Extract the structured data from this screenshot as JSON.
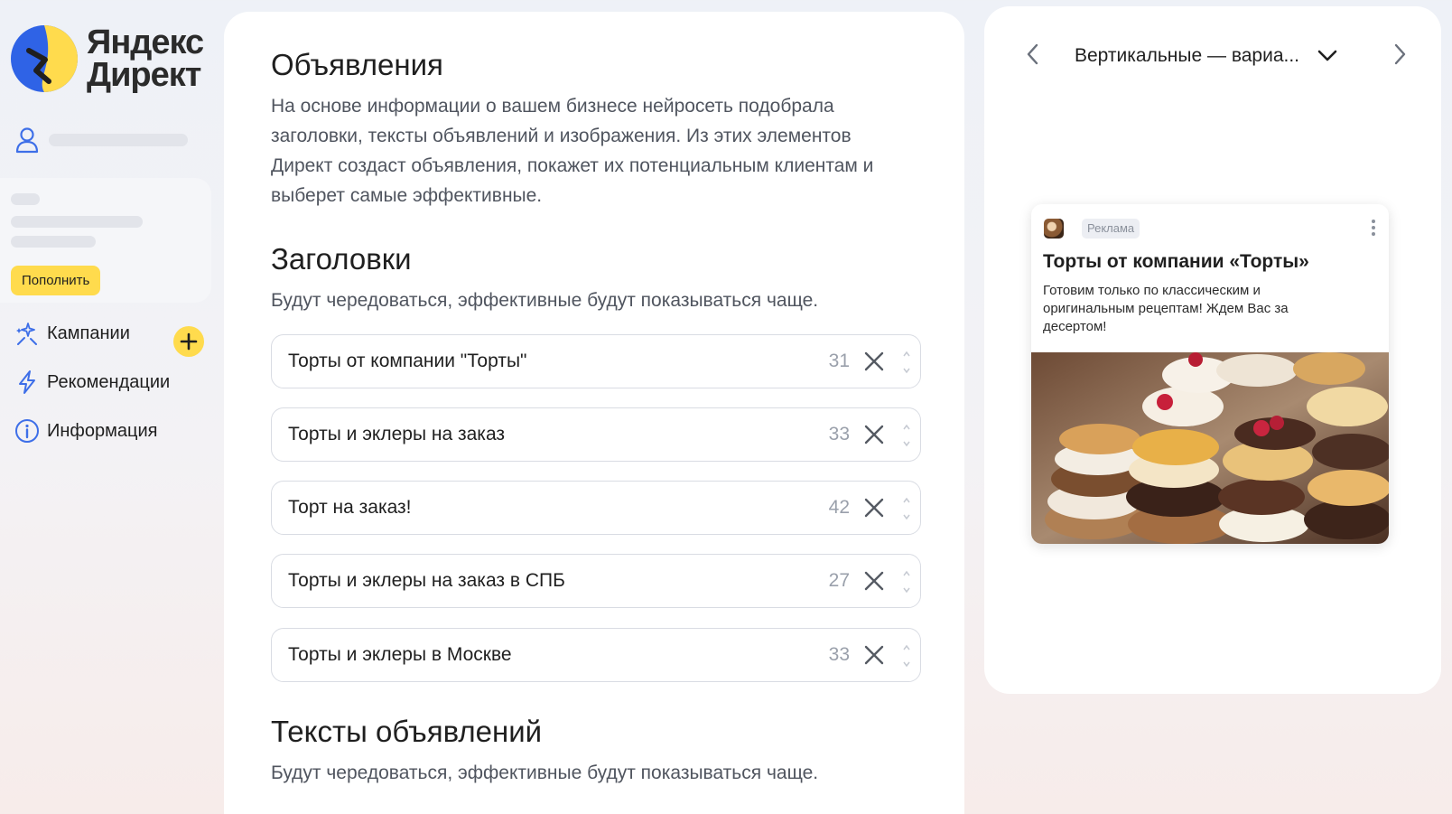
{
  "brand": {
    "line1": "Яндекс",
    "line2": "Директ"
  },
  "sidebar": {
    "topup_label": "Пополнить",
    "nav": [
      {
        "label": "Кампании",
        "icon": "sparkle-people-icon"
      },
      {
        "label": "Рекомендации",
        "icon": "lightning-icon"
      },
      {
        "label": "Информация",
        "icon": "info-icon"
      }
    ]
  },
  "main": {
    "ads_title": "Объявления",
    "ads_description": "На основе информации о вашем бизнесе нейросеть подобрала заголовки, тексты объявлений и изображения. Из этих элементов Директ создаст объявления, покажет их потенциальным клиентам и выберет самые эффективные.",
    "headlines_title": "Заголовки",
    "headlines_hint": "Будут чередоваться, эффективные будут показываться чаще.",
    "headlines": [
      {
        "value": "Торты от компании \"Торты\"",
        "count": "31"
      },
      {
        "value": "Торты и эклеры на заказ",
        "count": "33"
      },
      {
        "value": "Торт на заказ!",
        "count": "42"
      },
      {
        "value": "Торты и эклеры на заказ в СПБ",
        "count": "27"
      },
      {
        "value": "Торты и эклеры в Москве",
        "count": "33"
      }
    ],
    "texts_title": "Тексты объявлений",
    "texts_hint": "Будут чередоваться, эффективные будут показываться чаще."
  },
  "preview": {
    "format_label": "Вертикальные — вариа...",
    "ad": {
      "badge": "Реклама",
      "title": "Торты от компании «Торты»",
      "text": "Готовим только по классическим и оригинальным рецептам! Ждем Вас за десертом!"
    }
  },
  "colors": {
    "accent_yellow": "#ffdb4d",
    "logo_blue": "#2f63e6",
    "text_secondary": "#50555f",
    "count_gray": "#9aa0ab"
  }
}
